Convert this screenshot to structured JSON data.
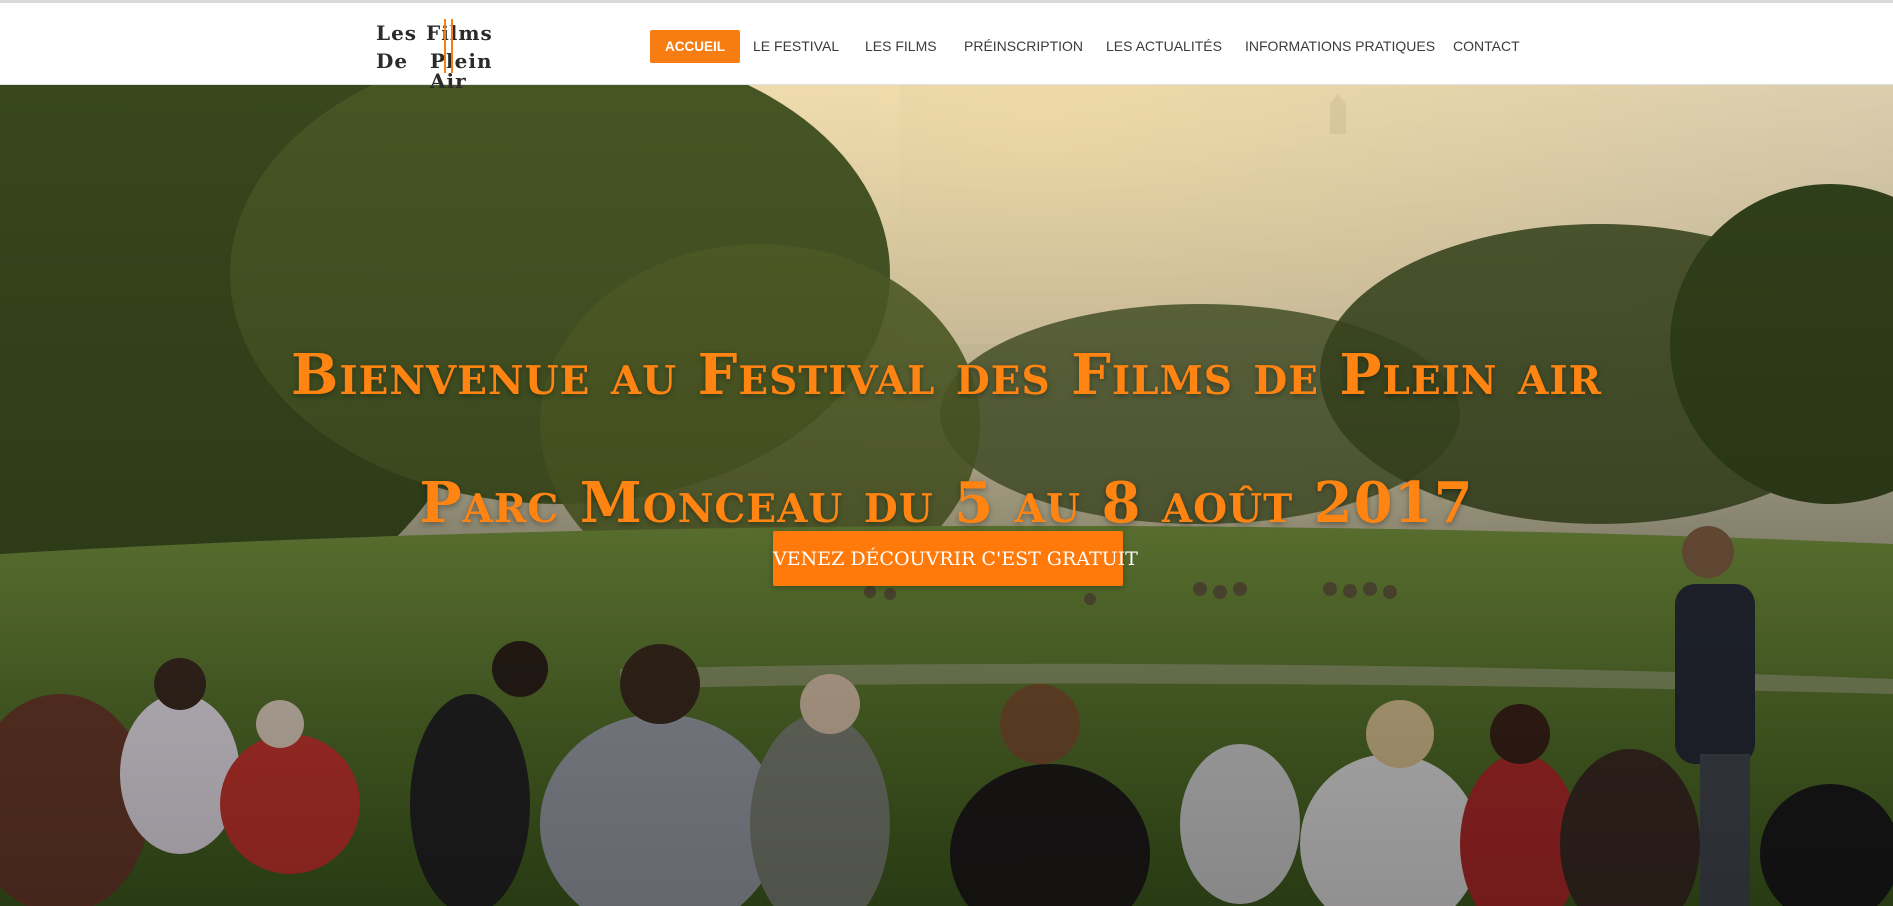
{
  "brand": {
    "logo_line1_left": "Les",
    "logo_line1_right": "Films",
    "logo_line2_left": "De",
    "logo_line2_right": "Plein Air",
    "accent_color": "#f77c11"
  },
  "nav": {
    "items": [
      {
        "label": "ACCUEIL",
        "active": true
      },
      {
        "label": "LE FESTIVAL",
        "active": false
      },
      {
        "label": "LES FILMS",
        "active": false
      },
      {
        "label": "PRÉINSCRIPTION",
        "active": false
      },
      {
        "label": "LES ACTUALITÉS",
        "active": false
      },
      {
        "label": "INFORMATIONS PRATIQUES",
        "active": false
      },
      {
        "label": "CONTACT",
        "active": false
      }
    ]
  },
  "hero": {
    "title": "Bienvenue au Festival des Films de Plein air",
    "subtitle": "Parc Monceau du 5 au 8 août 2017",
    "cta_label": "VENEZ DÉCOUVRIR C'EST GRATUIT",
    "background": "photo-outdoor-park-crowd-sunset",
    "text_color": "#ff8411"
  }
}
